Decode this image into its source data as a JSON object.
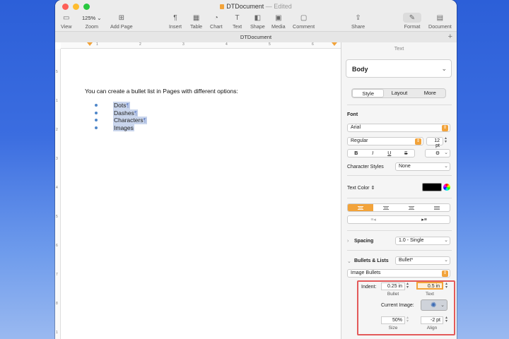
{
  "window": {
    "title": "DTDocument",
    "status": "— Edited",
    "tab_title": "DTDocument"
  },
  "toolbar": {
    "view": "View",
    "zoom_value": "125%",
    "zoom": "Zoom",
    "add_page": "Add Page",
    "insert": "Insert",
    "table": "Table",
    "chart": "Chart",
    "text": "Text",
    "shape": "Shape",
    "media": "Media",
    "comment": "Comment",
    "share": "Share",
    "format": "Format",
    "document": "Document"
  },
  "ruler": {
    "top": [
      "1",
      "2",
      "3",
      "4",
      "5",
      "6"
    ],
    "left": [
      "5",
      "1",
      "2",
      "3",
      "4",
      "5",
      "6",
      "7",
      "8",
      "1"
    ]
  },
  "document": {
    "heading": "You can create a bullet list in Pages with different options:",
    "bullets": [
      {
        "text": "Dots",
        "mark": "¶"
      },
      {
        "text": "Dashes",
        "mark": "¶"
      },
      {
        "text": "Characters",
        "mark": "¶"
      },
      {
        "text": "Images",
        "mark": ""
      }
    ]
  },
  "sidebar": {
    "header": "Text",
    "paragraph_style": "Body",
    "tabs": [
      "Style",
      "Layout",
      "More"
    ],
    "font_label": "Font",
    "font_name": "Arial",
    "font_style": "Regular",
    "font_size": "12 pt",
    "fmt": [
      "B",
      "I",
      "U",
      "S"
    ],
    "char_styles_label": "Character Styles",
    "char_styles_value": "None",
    "text_color_label": "Text Color",
    "text_color_value": "#000000",
    "spacing_label": "Spacing",
    "spacing_value": "1.0 - Single",
    "bullets_label": "Bullets & Lists",
    "bullets_value": "Bullet*",
    "bullet_type": "Image Bullets",
    "indent_label": "Indent:",
    "bullet_indent": "0.25 in",
    "text_indent": "0.5 in",
    "bullet_caption": "Bullet",
    "text_caption": "Text",
    "current_image_label": "Current Image:",
    "size_value": "50%",
    "align_value": "-2 pt",
    "size_caption": "Size",
    "align_caption": "Align"
  }
}
